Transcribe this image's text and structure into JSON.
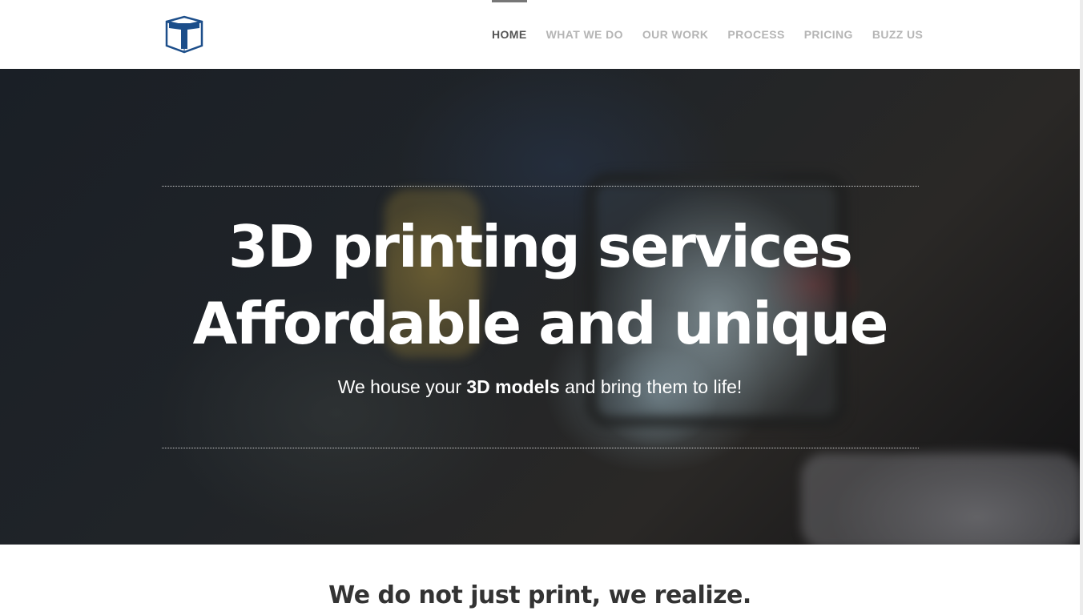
{
  "header": {
    "logo_icon": "cube-t-logo-icon",
    "nav": [
      {
        "label": "HOME",
        "active": true
      },
      {
        "label": "WHAT WE DO",
        "active": false
      },
      {
        "label": "OUR WORK",
        "active": false
      },
      {
        "label": "PROCESS",
        "active": false
      },
      {
        "label": "PRICING",
        "active": false
      },
      {
        "label": "BUZZ US",
        "active": false
      }
    ]
  },
  "hero": {
    "title_line1": "3D printing services",
    "title_line2": "Affordable and unique",
    "subtitle_before": "We house your ",
    "subtitle_bold": "3D models",
    "subtitle_after": " and bring them to life!"
  },
  "section": {
    "title": "We do not just print, we realize."
  },
  "colors": {
    "logo_blue": "#1c4e8a",
    "nav_active": "#555555",
    "nav_inactive": "#b5b5b5",
    "heading_dark": "#333333"
  }
}
